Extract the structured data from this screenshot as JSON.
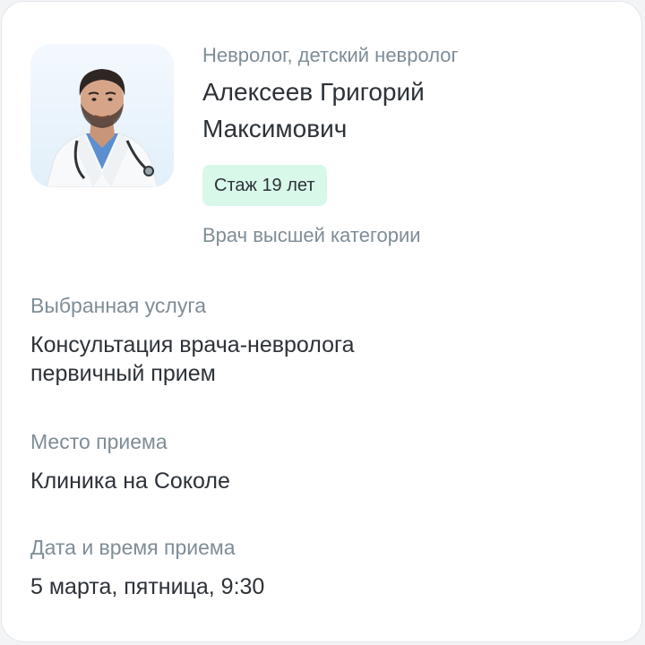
{
  "doctor": {
    "specialty": "Невролог, детский невролог",
    "name": "Алексеев Григорий Максимович",
    "experience_badge": "Стаж 19 лет",
    "category": "Врач высшей категории",
    "photo_icon": "doctor-photo"
  },
  "service": {
    "label": "Выбранная услуга",
    "value": "Консультация врача-невролога первичный прием"
  },
  "place": {
    "label": "Место приема",
    "value": "Клиника на Соколе"
  },
  "datetime": {
    "label": "Дата и время приема",
    "value": "5 марта, пятница, 9:30"
  },
  "colors": {
    "badge_bg": "#d8f8ea",
    "muted_text": "#7e8d97",
    "main_text": "#2d3238"
  }
}
